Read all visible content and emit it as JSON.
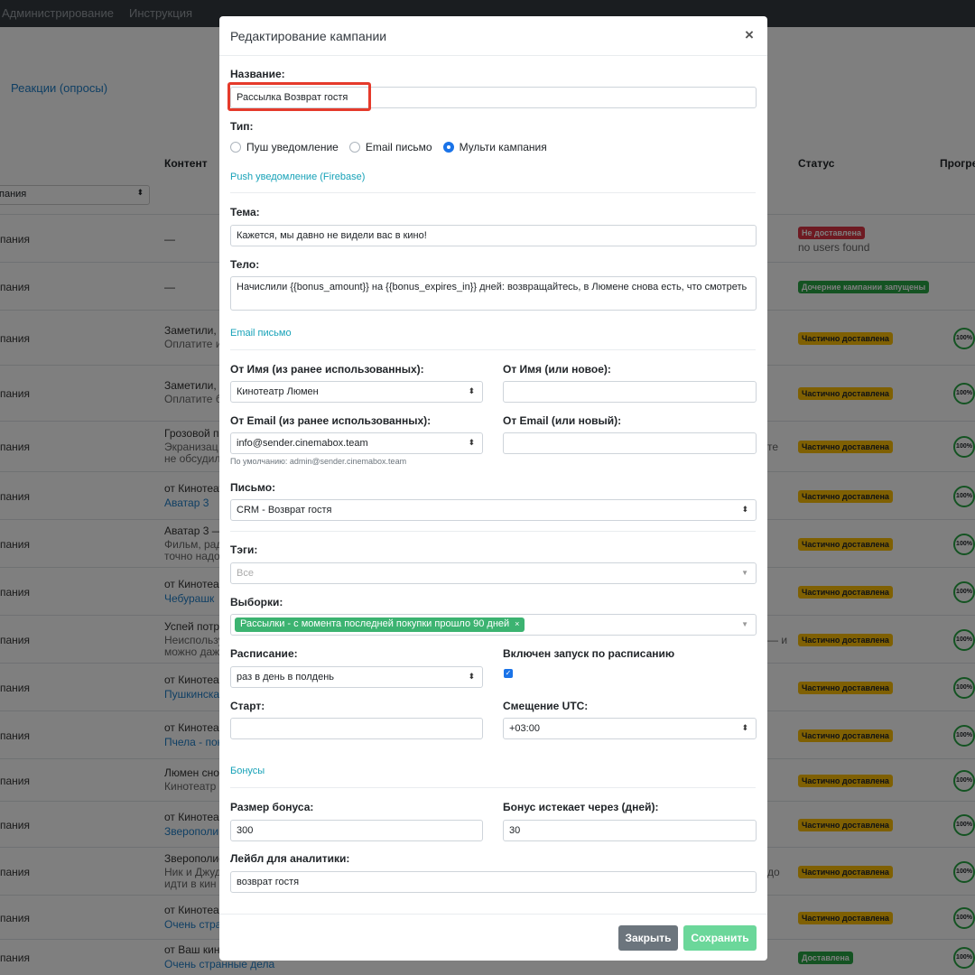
{
  "topnav": {
    "items": [
      "Администрирование",
      "Инструкция"
    ]
  },
  "background": {
    "link": "Реакции (опросы)",
    "columns": {
      "content": "Контент",
      "status": "Статус",
      "progress": "Прогре"
    },
    "filter_select": "пания",
    "rows": [
      {
        "c1": "пания",
        "c2": "—",
        "badge": "Не доставлена",
        "badge_color": "#dc3545",
        "sub": "no users found"
      },
      {
        "c1": "пания",
        "c2": "—",
        "badge": "Дочерние кампании запущены",
        "badge_color": "#28a745"
      },
      {
        "c1": "пания",
        "c2": "Заметили, ч",
        "c2b": "Оплатите и",
        "badge": "Частично доставлена",
        "badge_color": "#ffc107",
        "ring": "100%"
      },
      {
        "c1": "пания",
        "c2": "Заметили, ч",
        "c2b": "Оплатите б",
        "badge": "Частично доставлена",
        "badge_color": "#ffc107",
        "ring": "100%"
      },
      {
        "c1": "пания",
        "c2": "Грозовой по",
        "c2b": "Экранизац",
        "c2c": "не обсудил",
        "extra": "те",
        "badge": "Частично доставлена",
        "badge_color": "#ffc107",
        "ring": "100%"
      },
      {
        "c1": "пания",
        "c2": "от Кинотеат",
        "c2l": "Аватар 3",
        "badge": "Частично доставлена",
        "badge_color": "#ffc107",
        "ring": "100%"
      },
      {
        "c1": "пания",
        "c2": "Аватар 3 —",
        "c2b": "Фильм, рад",
        "c2c": "точно надо",
        "badge": "Частично доставлена",
        "badge_color": "#ffc107",
        "ring": "100%"
      },
      {
        "c1": "пания",
        "c2": "от Кинотеа",
        "c2l": "Чебурашк",
        "badge": "Частично доставлена",
        "badge_color": "#ffc107",
        "ring": "100%"
      },
      {
        "c1": "пания",
        "c2": "Успей потр",
        "c2b": "Неиспользу",
        "c2c": "можно даж",
        "extra": "— и",
        "badge": "Частично доставлена",
        "badge_color": "#ffc107",
        "ring": "100%"
      },
      {
        "c1": "пания",
        "c2": "от Кинотеа",
        "c2l": "Пушкинска",
        "badge": "Частично доставлена",
        "badge_color": "#ffc107",
        "ring": "100%"
      },
      {
        "c1": "пания",
        "c2": "от Кинотеа",
        "c2l": "Пчела - пок",
        "badge": "Частично доставлена",
        "badge_color": "#ffc107",
        "ring": "100%"
      },
      {
        "c1": "пания",
        "c2": "Люмен сно",
        "c2b": "Кинотеатр",
        "badge": "Частично доставлена",
        "badge_color": "#ffc107",
        "ring": "100%"
      },
      {
        "c1": "пания",
        "c2": "от Кинотеа",
        "c2l": "Зверополи",
        "badge": "Частично доставлена",
        "badge_color": "#ffc107",
        "ring": "100%"
      },
      {
        "c1": "пания",
        "c2": "Зверополис",
        "c2b": "Ник и Джуд",
        "c2c": "идти в кин",
        "extra": "до",
        "badge": "Частично доставлена",
        "badge_color": "#ffc107",
        "ring": "100%"
      },
      {
        "c1": "пания",
        "c2": "от Кинотеа",
        "c2l": "Очень стра",
        "badge": "Частично доставлена",
        "badge_color": "#ffc107",
        "ring": "100%"
      },
      {
        "c1": "пания",
        "c2": "от Ваш кин",
        "c2l": "Очень странные дела",
        "badge": "Доставлена",
        "badge_color": "#28a745",
        "ring": "100%"
      }
    ]
  },
  "modal": {
    "title": "Редактирование кампании",
    "close_icon": "×",
    "name_label": "Название:",
    "name_value": "Рассылка Возврат гостя",
    "type_label": "Тип:",
    "type_options": [
      "Пуш уведомление",
      "Email письмо",
      "Мульти кампания"
    ],
    "type_selected": "Мульти кампания",
    "push_section": "Push уведомление (Firebase)",
    "subject_label": "Тема:",
    "subject_value": "Кажется, мы давно не видели вас в кино!",
    "body_label": "Тело:",
    "body_value": "Начислили {{bonus_amount}} на {{bonus_expires_in}} дней: возвращайтесь, в Люмене снова есть, что смотреть",
    "email_section": "Email письмо",
    "from_name_prev_label": "От Имя (из ранее использованных):",
    "from_name_prev_value": "Кинотеатр Люмен",
    "from_name_new_label": "От Имя (или новое):",
    "from_name_new_value": "",
    "from_email_prev_label": "От Email (из ранее использованных):",
    "from_email_prev_value": "info@sender.cinemabox.team",
    "from_email_new_label": "От Email (или новый):",
    "from_email_new_value": "",
    "default_hint": "По умолчанию: admin@sender.cinemabox.team",
    "letter_label": "Письмо:",
    "letter_value": "CRM - Возврат гостя",
    "tags_label": "Тэги:",
    "tags_placeholder": "Все",
    "segments_label": "Выборки:",
    "segments_chip": "Рассылки - с момента последней покупки прошло 90 дней",
    "schedule_label": "Расписание:",
    "schedule_value": "раз в день в полдень",
    "schedule_enabled_label": "Включен запуск по расписанию",
    "schedule_enabled": true,
    "start_label": "Старт:",
    "start_value": "",
    "utc_label": "Смещение UTC:",
    "utc_value": "+03:00",
    "bonus_section": "Бонусы",
    "bonus_size_label": "Размер бонуса:",
    "bonus_size_value": "300",
    "bonus_expires_label": "Бонус истекает через (дней):",
    "bonus_expires_value": "30",
    "analytics_label": "Лейбл для аналитики:",
    "analytics_value": "возврат гостя",
    "close_button": "Закрыть",
    "save_button": "Сохранить",
    "accent_color": "#1a73e8",
    "highlight_color": "#e53a2b"
  }
}
